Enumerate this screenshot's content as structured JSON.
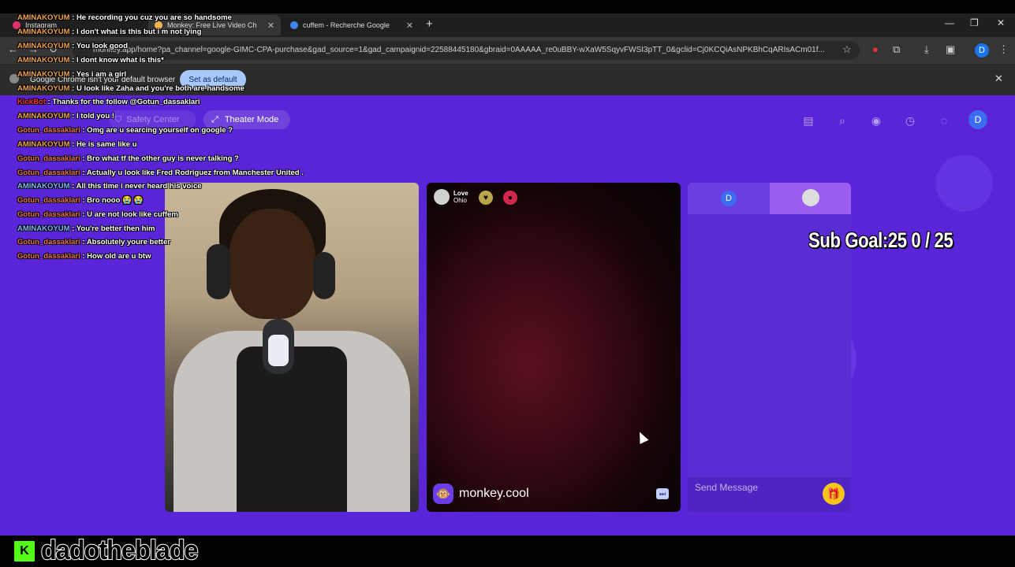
{
  "browser": {
    "tabs": [
      {
        "label": "Instagram",
        "active": false
      },
      {
        "label": "Monkey: Free Live Video Ch",
        "active": true
      },
      {
        "label": "cuffem - Recherche Google",
        "active": false
      }
    ],
    "new_tab_icon": "plus-icon",
    "url": "monkey.app/home?pa_channel=google-GIMC-CPA-purchase&gad_source=1&gad_campaignid=22588445180&gbraid=0AAAAA_re0uBBY-wXaW5SqyvFWSI3pTT_0&gclid=Cj0KCQiAsNPKBhCqARIsACm01f...",
    "profile_letter": "D",
    "infobar": {
      "text": "Google Chrome isn't your default browser",
      "button": "Set as default"
    }
  },
  "app": {
    "nav": {
      "safety_center": "Safety Center",
      "theater_mode": "Theater Mode",
      "avatar_letter": "D",
      "icons": [
        "shop-icon",
        "search-icon",
        "globe-icon",
        "history-icon",
        "chat-icon"
      ]
    },
    "remote": {
      "location_title": "Love",
      "location_sub": "Ohio",
      "username": "monkey.cool"
    },
    "chat": {
      "tab_letter": "D",
      "placeholder": "Send Message"
    },
    "colors": {
      "background": "#5a25d8",
      "accent": "#3d6cf0",
      "gift": "#f8c51c"
    }
  },
  "overlay": {
    "sub_goal": "Sub Goal:25  0 / 25",
    "streamer": "dadotheblade",
    "platform_icon": "kick-logo-icon",
    "chat": [
      {
        "user": "AMINAKOYUM",
        "msg": ": He recording you cuz you are so handsome",
        "c": "u1"
      },
      {
        "user": "AMINAKOYUM",
        "msg": ": I don't what is this but i m not lying",
        "c": "u1"
      },
      {
        "user": "AMINAKOYUM",
        "msg": ": You look good",
        "c": "u1"
      },
      {
        "user": "AMINAKOYUM",
        "msg": ": I dont know what is this*",
        "c": "u1"
      },
      {
        "user": "AMINAKOYUM",
        "msg": ": Yes i am a girl",
        "c": "u1"
      },
      {
        "user": "AMINAKOYUM",
        "msg": ": U look like Zaha and you're both are handsome",
        "c": "u1"
      },
      {
        "user": "KickBot",
        "msg": ": Thanks for the follow @Gotun_dassaklari",
        "c": "u3"
      },
      {
        "user": "AMINAKOYUM",
        "msg": ": I told you !",
        "c": "u1"
      },
      {
        "user": "Gotun_dassaklari",
        "msg": ": Omg are u searcing yourself on google ?",
        "c": "u2"
      },
      {
        "user": "AMINAKOYUM",
        "msg": ": He is same like u",
        "c": "u1"
      },
      {
        "user": "Gotun_dassaklari",
        "msg": ": Bro what tf the other guy is never talking ?",
        "c": "u2"
      },
      {
        "user": "Gotun_dassaklari",
        "msg": ": Actually u look like Fred Rodriguez from Manchester United .",
        "c": "u2"
      },
      {
        "user": "AMINAKOYUM",
        "msg": ": All this time i never heard his voice",
        "c": "u4"
      },
      {
        "user": "Gotun_dassaklari",
        "msg": ": Bro nooo 😭 😭",
        "c": "u2"
      },
      {
        "user": "Gotun_dassaklari",
        "msg": ": U are not look like cuffem",
        "c": "u2"
      },
      {
        "user": "AMINAKOYUM",
        "msg": ": You're better then him",
        "c": "u4"
      },
      {
        "user": "Gotun_dassaklari",
        "msg": ": Absolutely youre better",
        "c": "u2"
      },
      {
        "user": "Gotun_dassaklari",
        "msg": ": How old are u btw",
        "c": "u2"
      }
    ]
  }
}
